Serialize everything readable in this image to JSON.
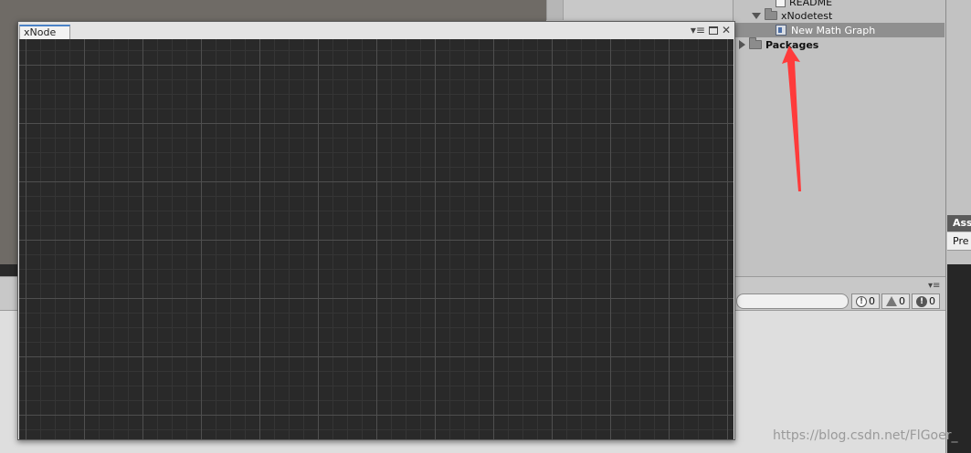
{
  "project_panel": {
    "items": [
      {
        "label": "README",
        "icon": "document-icon"
      },
      {
        "label": "xNodetest",
        "icon": "folder-icon"
      },
      {
        "label": "New Math Graph",
        "icon": "graph-asset-icon"
      },
      {
        "label": "Packages",
        "icon": "folder-icon"
      }
    ]
  },
  "xnode_window": {
    "tab_title": "xNode",
    "menu_glyph": "▾≡",
    "close_glyph": "✕"
  },
  "console_toolbar": {
    "info_count": "0",
    "warning_count": "0",
    "error_count": "0",
    "info_icon": "!",
    "error_icon": "!",
    "menu_glyph": "▾≡"
  },
  "right_edge": {
    "tab_label": "Ass",
    "subtab_label": "Pre"
  },
  "watermark": "https://blog.csdn.net/FlGoer_",
  "colors": {
    "annotation_arrow": "#ff3b3b",
    "tab_accent": "#4a82c7",
    "graph_background": "#292929"
  }
}
